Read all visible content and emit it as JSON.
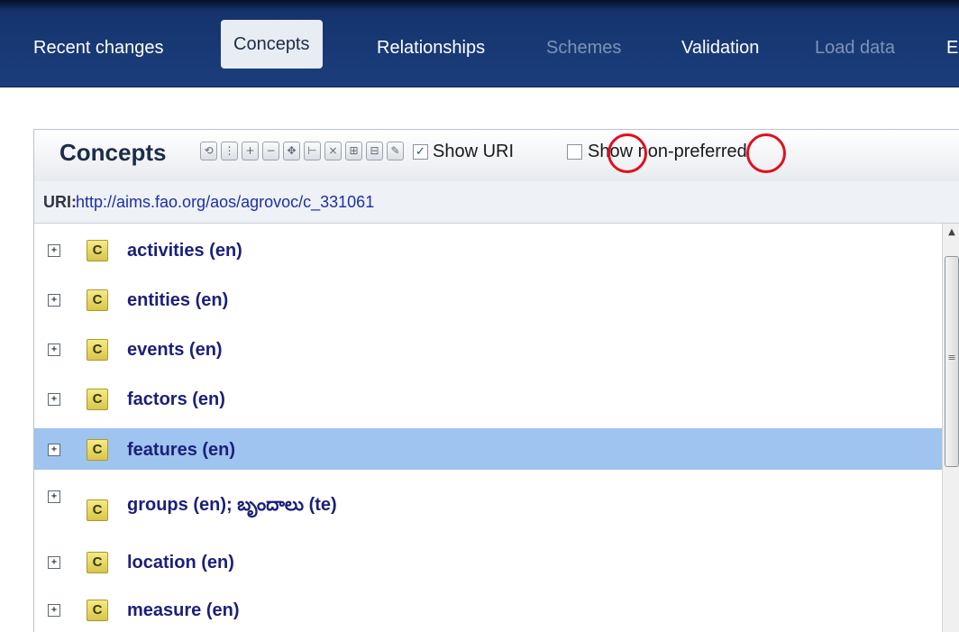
{
  "nav": {
    "tabs": [
      {
        "label": "Recent changes",
        "state": "normal"
      },
      {
        "label": "Concepts",
        "state": "active"
      },
      {
        "label": "Relationships",
        "state": "normal"
      },
      {
        "label": "Schemes",
        "state": "disabled"
      },
      {
        "label": "Validation",
        "state": "normal"
      },
      {
        "label": "Load data",
        "state": "disabled"
      },
      {
        "label": "E",
        "state": "normal"
      }
    ]
  },
  "panel": {
    "title": "Concepts",
    "toolbar_icons": [
      "refresh-icon",
      "hierarchy-icon",
      "expand-plus-icon",
      "collapse-minus-icon",
      "move-icon",
      "add-child-icon",
      "delete-icon",
      "add-sibling-icon",
      "remove-sibling-icon",
      "rename-icon"
    ],
    "show_uri": {
      "label": "Show URI",
      "checked": true
    },
    "show_nonpreferred": {
      "label": "Show non-preferred",
      "checked": false
    }
  },
  "uri": {
    "label": "URI:",
    "value": "http://aims.fao.org/aos/agrovoc/c_331061"
  },
  "tree": {
    "items": [
      {
        "label": "activities (en)",
        "badge": "C",
        "selected": false
      },
      {
        "label": "entities (en)",
        "badge": "C",
        "selected": false
      },
      {
        "label": "events (en)",
        "badge": "C",
        "selected": false
      },
      {
        "label": "factors (en)",
        "badge": "C",
        "selected": false
      },
      {
        "label": "features (en)",
        "badge": "C",
        "selected": true
      },
      {
        "label": "groups (en); బృందాలు (te)",
        "badge": "C",
        "selected": false
      },
      {
        "label": "location (en)",
        "badge": "C",
        "selected": false
      },
      {
        "label": "measure (en)",
        "badge": "C",
        "selected": false
      }
    ]
  },
  "colors": {
    "nav_bg": "#1b3e7c",
    "active_tab": "#e8edf3",
    "selected_row": "#9ec4ef",
    "annotation_circle": "#e0101c",
    "link": "#1e2fa6"
  }
}
